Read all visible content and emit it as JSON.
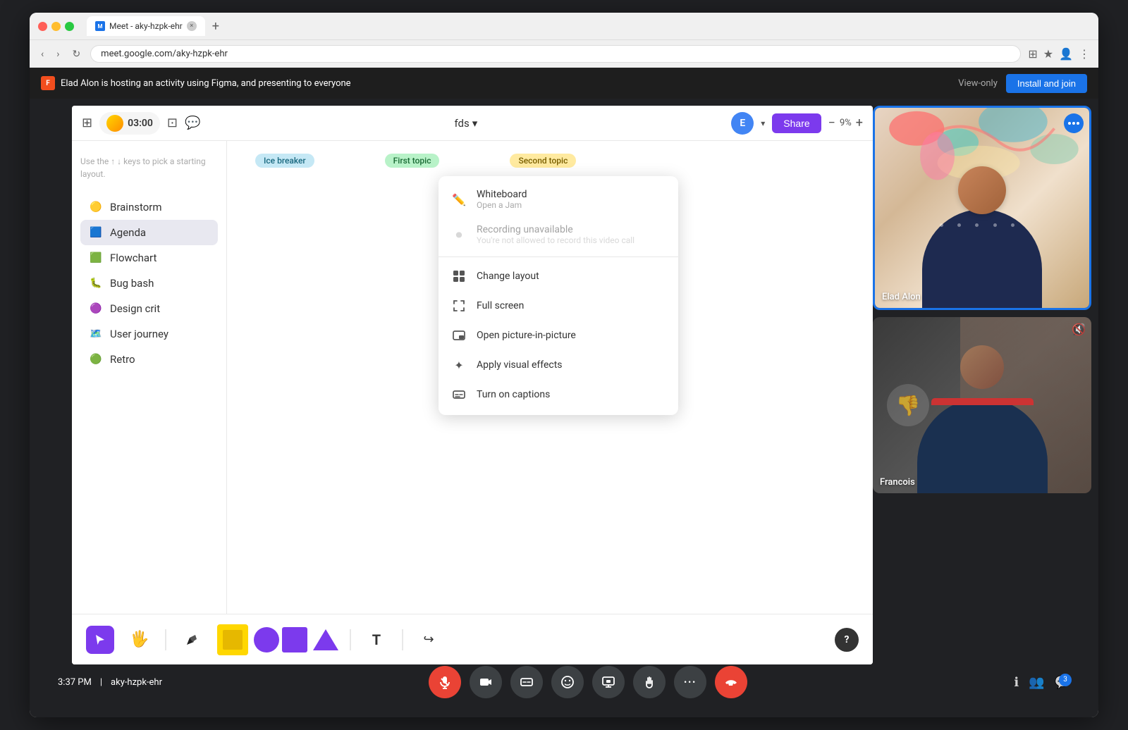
{
  "browser": {
    "url": "meet.google.com/aky-hzpk-ehr",
    "tab_title": "Meet - aky-hzpk-ehr",
    "tab_close": "×",
    "tab_new": "+",
    "nav": {
      "back": "‹",
      "forward": "›",
      "reload": "↻"
    },
    "browser_actions": [
      "⊞",
      "★",
      "⧉",
      "👤",
      "⋮"
    ]
  },
  "notification_bar": {
    "icon": "F",
    "text": "Elad Alon is hosting an activity using Figma, and presenting to everyone",
    "view_only": "View-only",
    "install_join": "Install and join"
  },
  "figma": {
    "file_name": "fds",
    "timer": "03:00",
    "user_initial": "E",
    "share_label": "Share",
    "zoom": "9%",
    "sidebar_hint": "Use the ↑ ↓ keys to pick a starting layout.",
    "items": [
      {
        "label": "Brainstorm",
        "icon": "🟡",
        "active": false
      },
      {
        "label": "Agenda",
        "icon": "🟦",
        "active": true
      },
      {
        "label": "Flowchart",
        "icon": "🟩",
        "active": false
      },
      {
        "label": "Bug bash",
        "icon": "🐞",
        "active": false
      },
      {
        "label": "Design crit",
        "icon": "🟣",
        "active": false
      },
      {
        "label": "User journey",
        "icon": "🗺️",
        "active": false
      },
      {
        "label": "Retro",
        "icon": "🟢",
        "active": false
      }
    ],
    "canvas_tags": [
      {
        "label": "Ice breaker",
        "class": "tag-ice"
      },
      {
        "label": "First topic",
        "class": "tag-first"
      },
      {
        "label": "Second topic",
        "class": "tag-second"
      }
    ]
  },
  "context_menu": {
    "items": [
      {
        "icon": "✏️",
        "label": "Whiteboard",
        "sub": "Open a Jam",
        "disabled": false,
        "id": "whiteboard"
      },
      {
        "icon": "⏺",
        "label": "Recording unavailable",
        "sub": "You're not allowed to record this video call",
        "disabled": true,
        "id": "recording"
      },
      {
        "icon": "⊞",
        "label": "Change layout",
        "sub": "",
        "disabled": false,
        "id": "layout"
      },
      {
        "icon": "⛶",
        "label": "Full screen",
        "sub": "",
        "disabled": false,
        "id": "fullscreen"
      },
      {
        "icon": "◫",
        "label": "Open picture-in-picture",
        "sub": "",
        "disabled": false,
        "id": "pip"
      },
      {
        "icon": "✦",
        "label": "Apply visual effects",
        "sub": "",
        "disabled": false,
        "id": "effects"
      },
      {
        "icon": "⧉",
        "label": "Turn on captions",
        "sub": "",
        "disabled": false,
        "id": "captions"
      }
    ]
  },
  "videos": [
    {
      "name": "Elad Alon",
      "muted": false
    },
    {
      "name": "Francois",
      "muted": true
    }
  ],
  "controls": {
    "time": "3:37 PM",
    "meeting_id": "aky-hzpk-ehr",
    "participants_count": "3",
    "buttons": [
      "🎤",
      "📷",
      "⊡",
      "😊",
      "📊",
      "✋",
      "⋮",
      "📞"
    ],
    "right_icons": [
      "ℹ",
      "👥",
      "💬"
    ]
  }
}
